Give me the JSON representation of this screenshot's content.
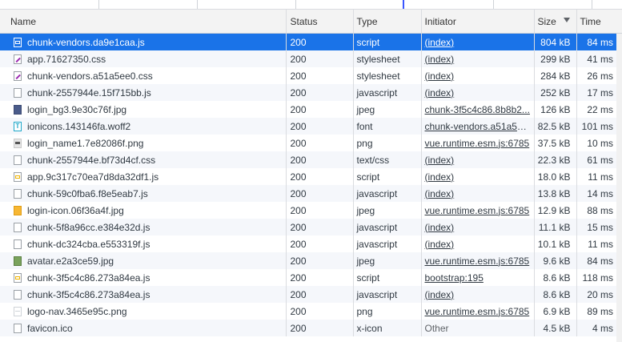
{
  "columns": {
    "name": "Name",
    "status": "Status",
    "type": "Type",
    "initiator": "Initiator",
    "size": "Size",
    "time": "Time"
  },
  "rows": [
    {
      "name": "chunk-vendors.da9e1caa.js",
      "status": "200",
      "type": "script",
      "initiator": "(index)",
      "size": "804 kB",
      "time": "84 ms",
      "icon": "js-file-icon"
    },
    {
      "name": "app.71627350.css",
      "status": "200",
      "type": "stylesheet",
      "initiator": "(index)",
      "size": "299 kB",
      "time": "41 ms",
      "icon": "css-file-icon"
    },
    {
      "name": "chunk-vendors.a51a5ee0.css",
      "status": "200",
      "type": "stylesheet",
      "initiator": "(index)",
      "size": "284 kB",
      "time": "26 ms",
      "icon": "css-file-icon"
    },
    {
      "name": "chunk-2557944e.15f715bb.js",
      "status": "200",
      "type": "javascript",
      "initiator": "(index)",
      "size": "252 kB",
      "time": "17 ms",
      "icon": "document-icon"
    },
    {
      "name": "login_bg3.9e30c76f.jpg",
      "status": "200",
      "type": "jpeg",
      "initiator": "chunk-3f5c4c86.8b8b2...",
      "size": "126 kB",
      "time": "22 ms",
      "icon": "image-icon"
    },
    {
      "name": "ionicons.143146fa.woff2",
      "status": "200",
      "type": "font",
      "initiator": "chunk-vendors.a51a5e...",
      "size": "82.5 kB",
      "time": "101 ms",
      "icon": "font-file-icon"
    },
    {
      "name": "login_name1.7e82086f.png",
      "status": "200",
      "type": "png",
      "initiator": "vue.runtime.esm.js:6785",
      "size": "37.5 kB",
      "time": "10 ms",
      "icon": "image-icon"
    },
    {
      "name": "chunk-2557944e.bf73d4cf.css",
      "status": "200",
      "type": "text/css",
      "initiator": "(index)",
      "size": "22.3 kB",
      "time": "61 ms",
      "icon": "document-icon"
    },
    {
      "name": "app.9c317c70ea7d8da32df1.js",
      "status": "200",
      "type": "script",
      "initiator": "(index)",
      "size": "18.0 kB",
      "time": "11 ms",
      "icon": "js-file-icon"
    },
    {
      "name": "chunk-59c0fba6.f8e5eab7.js",
      "status": "200",
      "type": "javascript",
      "initiator": "(index)",
      "size": "13.8 kB",
      "time": "14 ms",
      "icon": "document-icon"
    },
    {
      "name": "login-icon.06f36a4f.jpg",
      "status": "200",
      "type": "jpeg",
      "initiator": "vue.runtime.esm.js:6785",
      "size": "12.9 kB",
      "time": "88 ms",
      "icon": "image-icon"
    },
    {
      "name": "chunk-5f8a96cc.e384e32d.js",
      "status": "200",
      "type": "javascript",
      "initiator": "(index)",
      "size": "11.1 kB",
      "time": "15 ms",
      "icon": "document-icon"
    },
    {
      "name": "chunk-dc324cba.e553319f.js",
      "status": "200",
      "type": "javascript",
      "initiator": "(index)",
      "size": "10.1 kB",
      "time": "11 ms",
      "icon": "document-icon"
    },
    {
      "name": "avatar.e2a3ce59.jpg",
      "status": "200",
      "type": "jpeg",
      "initiator": "vue.runtime.esm.js:6785",
      "size": "9.6 kB",
      "time": "84 ms",
      "icon": "image-icon"
    },
    {
      "name": "chunk-3f5c4c86.273a84ea.js",
      "status": "200",
      "type": "script",
      "initiator": "bootstrap:195",
      "size": "8.6 kB",
      "time": "118 ms",
      "icon": "js-file-icon"
    },
    {
      "name": "chunk-3f5c4c86.273a84ea.js",
      "status": "200",
      "type": "javascript",
      "initiator": "(index)",
      "size": "8.6 kB",
      "time": "20 ms",
      "icon": "document-icon"
    },
    {
      "name": "logo-nav.3465e95c.png",
      "status": "200",
      "type": "png",
      "initiator": "vue.runtime.esm.js:6785",
      "size": "6.9 kB",
      "time": "89 ms",
      "icon": "image-icon"
    },
    {
      "name": "favicon.ico",
      "status": "200",
      "type": "x-icon",
      "initiator": "Other",
      "size": "4.5 kB",
      "time": "4 ms",
      "icon": "document-icon"
    }
  ]
}
